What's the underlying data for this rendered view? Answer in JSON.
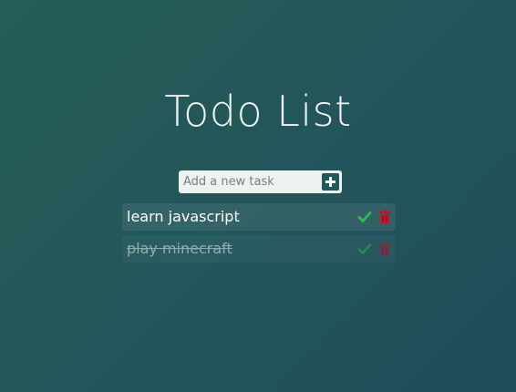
{
  "app": {
    "title": "Todo List"
  },
  "add_form": {
    "placeholder": "Add a new task",
    "add_icon": "plus-square-icon"
  },
  "todos": [
    {
      "text": "learn javascript",
      "completed": false
    },
    {
      "text": "play minecraft",
      "completed": true
    }
  ],
  "colors": {
    "background_start": "#245e56",
    "background_end": "#214c5c",
    "check": "#27c24c",
    "trash": "#c8102e",
    "add_button": "#1f5a5b"
  },
  "icons": {
    "complete": "check-icon",
    "delete": "trash-icon"
  }
}
